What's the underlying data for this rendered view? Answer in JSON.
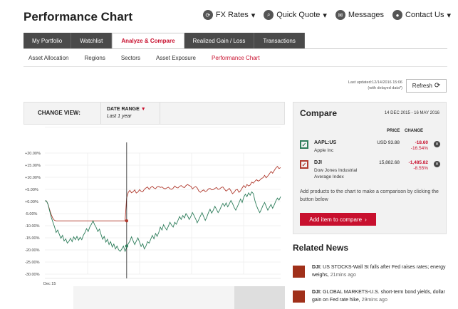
{
  "header": {
    "title": "Performance Chart",
    "links": [
      {
        "label": "FX Rates",
        "icon": "refresh-icon",
        "caret": "▾"
      },
      {
        "label": "Quick Quote",
        "icon": "search-icon",
        "caret": "▾"
      },
      {
        "label": "Messages",
        "icon": "envelope-icon",
        "caret": ""
      },
      {
        "label": "Contact Us",
        "icon": "person-icon",
        "caret": "▾"
      }
    ]
  },
  "tabs": [
    "My Portfolio",
    "Watchlist",
    "Analyze & Compare",
    "Realized Gain / Loss",
    "Transactions"
  ],
  "active_tab": 2,
  "subtabs": [
    "Asset Allocation",
    "Regions",
    "Sectors",
    "Asset Exposure",
    "Performance Chart"
  ],
  "active_subtab": 4,
  "update": {
    "line1": "Last updated:12/14/2016 15:06",
    "line2": "(with delayed data*)",
    "refresh_label": "Refresh"
  },
  "change_view": {
    "label": "CHANGE VIEW:",
    "date_range_label": "DATE RANGE",
    "date_range_value": "Last 1 year"
  },
  "chart_data": {
    "type": "line",
    "title": "",
    "xlabel": "",
    "ylabel": "",
    "x_tick_labels": [
      "Dec 15"
    ],
    "ylim": [
      -30,
      20
    ],
    "y_ticks": [
      "+20.00%",
      "+15.00%",
      "+10.00%",
      "+5.00%",
      "+0.00%",
      "-5.00%",
      "-10.00%",
      "-15.00%",
      "-20.00%",
      "-25.00%",
      "-30.00%"
    ],
    "grid": true,
    "series": [
      {
        "name": "DJI",
        "color": "#b03a2e",
        "values": [
          0.3,
          0.2,
          -1.2,
          -3.5,
          -5.5,
          -7.0,
          -7.8,
          -8.0,
          -8.0,
          -8.0,
          -8.0,
          -8.0,
          -8.0,
          -8.0,
          -8.0,
          -8.0,
          -8.0,
          -8.0,
          -8.0,
          -8.0,
          -8.0,
          -8.0,
          -8.0,
          -8.0,
          -8.0,
          -8.0,
          -8.0,
          -8.0,
          -8.0,
          -8.0,
          -8.0,
          -8.0,
          -8.0,
          -8.0,
          -8.0,
          -8.0,
          -8.0,
          -8.0,
          -8.0,
          -8.0,
          -8.0,
          -8.0,
          -8.0,
          -8.0,
          -8.0,
          -8.0,
          -8.0,
          -8.0,
          -8.0,
          -8.0,
          -8.0,
          1.5,
          3.8,
          4.6,
          3.6,
          4.0,
          4.8,
          3.5,
          3.9,
          4.9,
          4.2,
          4.0,
          5.0,
          5.6,
          6.0,
          5.0,
          5.8,
          6.3,
          5.6,
          5.3,
          6.1,
          6.2,
          5.8,
          6.0,
          5.5,
          5.2,
          5.6,
          5.9,
          5.3,
          5.0,
          5.5,
          6.4,
          5.8,
          5.6,
          6.3,
          6.6,
          6.0,
          5.7,
          6.6,
          7.0,
          6.6,
          6.3,
          5.2,
          5.8,
          6.2,
          5.6,
          4.3,
          3.8,
          4.4,
          4.8,
          4.1,
          4.4,
          5.2,
          5.4,
          4.8,
          4.9,
          5.4,
          5.8,
          5.0,
          5.2,
          5.8,
          6.0,
          5.1,
          4.3,
          4.8,
          5.4,
          4.4,
          3.2,
          3.8,
          4.8,
          5.0,
          3.8,
          4.4,
          5.6,
          6.6,
          5.8,
          7.0,
          6.4,
          6.8,
          8.0,
          7.6,
          8.4,
          9.0,
          8.4,
          8.8,
          9.5,
          9.8,
          10.8,
          9.8,
          10.6,
          11.4,
          12.4,
          11.7,
          12.8,
          13.8,
          14.5,
          13.6,
          14.0
        ]
      },
      {
        "name": "AAPL:US",
        "color": "#2e7d5b",
        "values": [
          0.3,
          0.2,
          -1.3,
          -4.0,
          -6.5,
          -8.6,
          -10.4,
          -12.8,
          -11.8,
          -13.6,
          -15.2,
          -14.0,
          -16.3,
          -15.4,
          -17.2,
          -16.4,
          -15.2,
          -16.6,
          -14.6,
          -15.8,
          -14.4,
          -16.0,
          -14.8,
          -15.8,
          -14.0,
          -12.8,
          -11.2,
          -12.4,
          -10.6,
          -9.4,
          -8.0,
          -9.6,
          -10.8,
          -12.4,
          -11.4,
          -13.6,
          -15.6,
          -14.4,
          -16.8,
          -15.6,
          -17.8,
          -16.6,
          -18.8,
          -17.6,
          -19.6,
          -18.4,
          -20.0,
          -20.6,
          -19.6,
          -18.4,
          -20.6,
          -19.0,
          -17.4,
          -16.4,
          -14.6,
          -16.2,
          -17.8,
          -16.4,
          -15.0,
          -16.8,
          -18.6,
          -17.4,
          -19.6,
          -18.4,
          -16.6,
          -17.2,
          -15.6,
          -14.0,
          -15.4,
          -13.2,
          -14.4,
          -12.8,
          -10.6,
          -11.8,
          -9.6,
          -10.8,
          -11.8,
          -10.2,
          -8.6,
          -9.8,
          -10.6,
          -8.6,
          -9.4,
          -7.8,
          -6.2,
          -7.4,
          -5.8,
          -6.8,
          -5.0,
          -6.0,
          -7.4,
          -6.2,
          -4.6,
          -5.8,
          -7.2,
          -8.8,
          -7.4,
          -6.0,
          -4.6,
          -6.2,
          -7.8,
          -6.4,
          -4.6,
          -3.2,
          -4.8,
          -3.6,
          -2.0,
          -3.2,
          -4.6,
          -3.6,
          -2.0,
          -0.8,
          -2.0,
          -0.6,
          -2.2,
          -1.0,
          0.4,
          -0.8,
          -2.4,
          -3.6,
          -2.2,
          -0.6,
          1.0,
          -0.4,
          1.8,
          3.0,
          2.0,
          3.6,
          2.6,
          4.0,
          3.2,
          0.2,
          -1.8,
          -3.4,
          -4.6,
          -3.2,
          -1.6,
          -0.4,
          -2.0,
          -3.6,
          -2.4,
          -1.2,
          -2.8,
          -1.4,
          0.2,
          1.4,
          0.6,
          2.0
        ]
      }
    ],
    "crosshair_index": 51,
    "crosshair_values": {
      "DJI": -8.0,
      "AAPL:US": -18.4
    }
  },
  "compare": {
    "title": "Compare",
    "date_range": "14 DEC 2015 - 16 MAY 2016",
    "col_price": "PRICE",
    "col_change": "CHANGE",
    "items": [
      {
        "ticker": "AAPL:US",
        "name": "Apple Inc",
        "price": "USD  93.88",
        "change": "-18.60",
        "change_pct": "-16.54%",
        "color": "#2e7d5b",
        "check": "✓"
      },
      {
        "ticker": "DJI",
        "name": "Dow Jones Industrial Average Index",
        "price": "15,882.68",
        "change": "-1,485.82",
        "change_pct": "-8.55%",
        "color": "#b03a2e",
        "check": "✓"
      }
    ],
    "hint": "Add products to the chart to make a comparison by clicking the button below",
    "add_label": "Add item to compare",
    "add_chevron": "›",
    "remove_glyph": "✕"
  },
  "related_news": {
    "title": "Related News",
    "items": [
      {
        "source": "DJI:",
        "headline": " US STOCKS-Wall St falls after Fed raises rates; energy weighs, ",
        "time": "21mins ago"
      },
      {
        "source": "DJI:",
        "headline": " GLOBAL MARKETS-U.S. short-term bond yields, dollar gain on Fed rate hike, ",
        "time": "29mins ago"
      }
    ]
  }
}
